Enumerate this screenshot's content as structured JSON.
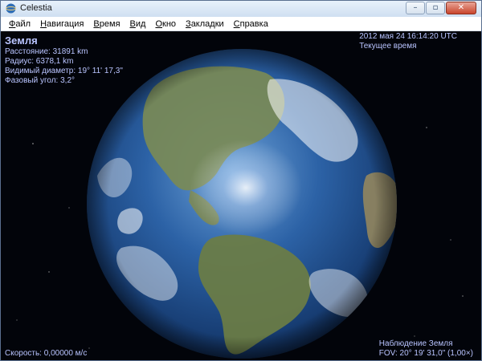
{
  "window": {
    "title": "Celestia",
    "minimize_glyph": "–",
    "maximize_glyph": "▫",
    "close_glyph": "✕"
  },
  "menu": {
    "items": [
      {
        "label": "Файл"
      },
      {
        "label": "Навигация"
      },
      {
        "label": "Время"
      },
      {
        "label": "Вид"
      },
      {
        "label": "Окно"
      },
      {
        "label": "Закладки"
      },
      {
        "label": "Справка"
      }
    ]
  },
  "hud": {
    "object_name": "Земля",
    "distance": "Расстояние: 31891 km",
    "radius": "Радиус: 6378,1 km",
    "apparent_diameter": "Видимый диаметр: 19° 11' 17,3\"",
    "phase_angle": "Фазовый угол: 3,2°",
    "datetime": "2012 мая 24 16:14:20 UTC",
    "time_mode": "Текущее время",
    "speed": "Скорость: 0,00000 м/с",
    "view_mode": "Наблюдение Земля",
    "fov": "FOV: 20° 19' 31,0\" (1,00×)"
  },
  "colors": {
    "hud_text": "#b9c4ff",
    "space": "#02040a",
    "ocean": "#1f4f8f",
    "land": "#6d7d4b"
  },
  "icons": {
    "app": "celestia-app-icon",
    "minimize": "minimize-icon",
    "maximize": "maximize-icon",
    "close": "close-icon"
  }
}
